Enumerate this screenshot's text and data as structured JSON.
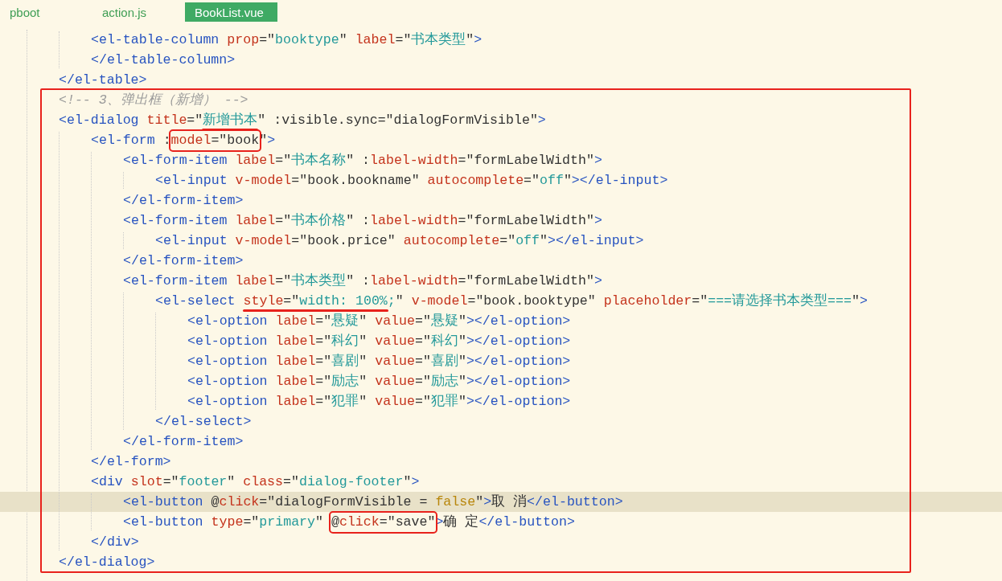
{
  "tabs": [
    {
      "label": "pboot",
      "selected": false
    },
    {
      "label": "action.js",
      "selected": false
    },
    {
      "label": "BookList.vue",
      "selected": true
    }
  ],
  "sections": [
    {
      "boxed": false,
      "lines": [
        {
          "children": [
            {
              "current": false,
              "tokens": [
                {
                  "kind": "tag",
                  "text": "<el-table-column"
                },
                {
                  "kind": "attr",
                  "text": " prop"
                },
                {
                  "kind": "punct",
                  "text": "=\""
                },
                {
                  "kind": "string",
                  "text": "booktype"
                },
                {
                  "kind": "punct",
                  "text": "\""
                },
                {
                  "kind": "attr",
                  "text": " label"
                },
                {
                  "kind": "punct",
                  "text": "=\""
                },
                {
                  "kind": "string",
                  "text": "书本类型"
                },
                {
                  "kind": "punct",
                  "text": "\""
                },
                {
                  "kind": "tag",
                  "text": ">"
                }
              ]
            },
            {
              "current": false,
              "tokens": [
                {
                  "kind": "tag",
                  "text": "</el-table-column>"
                }
              ]
            }
          ]
        },
        {
          "current": false,
          "tokens": [
            {
              "kind": "tag",
              "text": "</el-table>"
            }
          ]
        }
      ]
    },
    {
      "boxed": true,
      "lines": [
        {
          "current": false,
          "tokens": [
            {
              "kind": "comment",
              "text": "<!-- 3、弹出框（新增） -->"
            }
          ]
        },
        {
          "current": false,
          "tokens": [
            {
              "kind": "tag",
              "text": "<el-dialog"
            },
            {
              "kind": "attr",
              "text": " title"
            },
            {
              "kind": "punct",
              "text": "=\""
            },
            {
              "kind": "underlined",
              "tokens": [
                {
                  "kind": "string",
                  "text": "新增书本"
                }
              ]
            },
            {
              "kind": "punct",
              "text": "\""
            },
            {
              "kind": "punct",
              "text": " :visible.sync"
            },
            {
              "kind": "punct",
              "text": "=\""
            },
            {
              "kind": "expr",
              "text": "dialogFormVisible"
            },
            {
              "kind": "punct",
              "text": "\""
            },
            {
              "kind": "tag",
              "text": ">"
            }
          ],
          "children": [
            {
              "current": false,
              "tokens": [
                {
                  "kind": "tag",
                  "text": "<el-form"
                },
                {
                  "kind": "punct",
                  "text": " :"
                },
                {
                  "kind": "boxed",
                  "tokens": [
                    {
                      "kind": "attr",
                      "text": "model"
                    },
                    {
                      "kind": "punct",
                      "text": "=\""
                    },
                    {
                      "kind": "expr",
                      "text": "book"
                    }
                  ]
                },
                {
                  "kind": "punct",
                  "text": "\""
                },
                {
                  "kind": "tag",
                  "text": ">"
                }
              ],
              "children": [
                {
                  "current": false,
                  "tokens": [
                    {
                      "kind": "tag",
                      "text": "<el-form-item"
                    },
                    {
                      "kind": "attr",
                      "text": " label"
                    },
                    {
                      "kind": "punct",
                      "text": "=\""
                    },
                    {
                      "kind": "string",
                      "text": "书本名称"
                    },
                    {
                      "kind": "punct",
                      "text": "\""
                    },
                    {
                      "kind": "punct",
                      "text": " :"
                    },
                    {
                      "kind": "attr",
                      "text": "label-width"
                    },
                    {
                      "kind": "punct",
                      "text": "=\""
                    },
                    {
                      "kind": "expr",
                      "text": "formLabelWidth"
                    },
                    {
                      "kind": "punct",
                      "text": "\""
                    },
                    {
                      "kind": "tag",
                      "text": ">"
                    }
                  ],
                  "children": [
                    {
                      "current": false,
                      "tokens": [
                        {
                          "kind": "tag",
                          "text": "<el-input"
                        },
                        {
                          "kind": "attr",
                          "text": " v-model"
                        },
                        {
                          "kind": "punct",
                          "text": "=\""
                        },
                        {
                          "kind": "expr",
                          "text": "book.bookname"
                        },
                        {
                          "kind": "punct",
                          "text": "\""
                        },
                        {
                          "kind": "attr",
                          "text": " autocomplete"
                        },
                        {
                          "kind": "punct",
                          "text": "=\""
                        },
                        {
                          "kind": "string",
                          "text": "off"
                        },
                        {
                          "kind": "punct",
                          "text": "\""
                        },
                        {
                          "kind": "tag",
                          "text": "></el-input>"
                        }
                      ]
                    }
                  ]
                },
                {
                  "current": false,
                  "tokens": [
                    {
                      "kind": "tag",
                      "text": "</el-form-item>"
                    }
                  ]
                },
                {
                  "current": false,
                  "tokens": [
                    {
                      "kind": "tag",
                      "text": "<el-form-item"
                    },
                    {
                      "kind": "attr",
                      "text": " label"
                    },
                    {
                      "kind": "punct",
                      "text": "=\""
                    },
                    {
                      "kind": "string",
                      "text": "书本价格"
                    },
                    {
                      "kind": "punct",
                      "text": "\""
                    },
                    {
                      "kind": "punct",
                      "text": " :"
                    },
                    {
                      "kind": "attr",
                      "text": "label-width"
                    },
                    {
                      "kind": "punct",
                      "text": "=\""
                    },
                    {
                      "kind": "expr",
                      "text": "formLabelWidth"
                    },
                    {
                      "kind": "punct",
                      "text": "\""
                    },
                    {
                      "kind": "tag",
                      "text": ">"
                    }
                  ],
                  "children": [
                    {
                      "current": false,
                      "tokens": [
                        {
                          "kind": "tag",
                          "text": "<el-input"
                        },
                        {
                          "kind": "attr",
                          "text": " v-model"
                        },
                        {
                          "kind": "punct",
                          "text": "=\""
                        },
                        {
                          "kind": "expr",
                          "text": "book.price"
                        },
                        {
                          "kind": "punct",
                          "text": "\""
                        },
                        {
                          "kind": "attr",
                          "text": " autocomplete"
                        },
                        {
                          "kind": "punct",
                          "text": "=\""
                        },
                        {
                          "kind": "string",
                          "text": "off"
                        },
                        {
                          "kind": "punct",
                          "text": "\""
                        },
                        {
                          "kind": "tag",
                          "text": "></el-input>"
                        }
                      ]
                    }
                  ]
                },
                {
                  "current": false,
                  "tokens": [
                    {
                      "kind": "tag",
                      "text": "</el-form-item>"
                    }
                  ]
                },
                {
                  "current": false,
                  "tokens": [
                    {
                      "kind": "tag",
                      "text": "<el-form-item"
                    },
                    {
                      "kind": "attr",
                      "text": " label"
                    },
                    {
                      "kind": "punct",
                      "text": "=\""
                    },
                    {
                      "kind": "string",
                      "text": "书本类型"
                    },
                    {
                      "kind": "punct",
                      "text": "\""
                    },
                    {
                      "kind": "punct",
                      "text": " :"
                    },
                    {
                      "kind": "attr",
                      "text": "label-width"
                    },
                    {
                      "kind": "punct",
                      "text": "=\""
                    },
                    {
                      "kind": "expr",
                      "text": "formLabelWidth"
                    },
                    {
                      "kind": "punct",
                      "text": "\""
                    },
                    {
                      "kind": "tag",
                      "text": ">"
                    }
                  ],
                  "children": [
                    {
                      "current": false,
                      "tokens": [
                        {
                          "kind": "tag",
                          "text": "<el-select "
                        },
                        {
                          "kind": "underlined",
                          "tokens": [
                            {
                              "kind": "attr",
                              "text": "style"
                            },
                            {
                              "kind": "punct",
                              "text": "=\""
                            },
                            {
                              "kind": "string",
                              "text": "width: 100%"
                            }
                          ]
                        },
                        {
                          "kind": "string",
                          "text": ";"
                        },
                        {
                          "kind": "punct",
                          "text": "\""
                        },
                        {
                          "kind": "attr",
                          "text": " v-model"
                        },
                        {
                          "kind": "punct",
                          "text": "=\""
                        },
                        {
                          "kind": "expr",
                          "text": "book.booktype"
                        },
                        {
                          "kind": "punct",
                          "text": "\""
                        },
                        {
                          "kind": "attr",
                          "text": " placeholder"
                        },
                        {
                          "kind": "punct",
                          "text": "=\""
                        },
                        {
                          "kind": "string",
                          "text": "===请选择书本类型==="
                        },
                        {
                          "kind": "punct",
                          "text": "\""
                        },
                        {
                          "kind": "tag",
                          "text": ">"
                        }
                      ],
                      "children": [
                        {
                          "current": false,
                          "tokens": [
                            {
                              "kind": "tag",
                              "text": "<el-option"
                            },
                            {
                              "kind": "attr",
                              "text": " label"
                            },
                            {
                              "kind": "punct",
                              "text": "=\""
                            },
                            {
                              "kind": "string",
                              "text": "悬疑"
                            },
                            {
                              "kind": "punct",
                              "text": "\""
                            },
                            {
                              "kind": "attr",
                              "text": " value"
                            },
                            {
                              "kind": "punct",
                              "text": "=\""
                            },
                            {
                              "kind": "string",
                              "text": "悬疑"
                            },
                            {
                              "kind": "punct",
                              "text": "\""
                            },
                            {
                              "kind": "tag",
                              "text": "></el-option>"
                            }
                          ]
                        },
                        {
                          "current": false,
                          "tokens": [
                            {
                              "kind": "tag",
                              "text": "<el-option"
                            },
                            {
                              "kind": "attr",
                              "text": " label"
                            },
                            {
                              "kind": "punct",
                              "text": "=\""
                            },
                            {
                              "kind": "string",
                              "text": "科幻"
                            },
                            {
                              "kind": "punct",
                              "text": "\""
                            },
                            {
                              "kind": "attr",
                              "text": " value"
                            },
                            {
                              "kind": "punct",
                              "text": "=\""
                            },
                            {
                              "kind": "string",
                              "text": "科幻"
                            },
                            {
                              "kind": "punct",
                              "text": "\""
                            },
                            {
                              "kind": "tag",
                              "text": "></el-option>"
                            }
                          ]
                        },
                        {
                          "current": false,
                          "tokens": [
                            {
                              "kind": "tag",
                              "text": "<el-option"
                            },
                            {
                              "kind": "attr",
                              "text": " label"
                            },
                            {
                              "kind": "punct",
                              "text": "=\""
                            },
                            {
                              "kind": "string",
                              "text": "喜剧"
                            },
                            {
                              "kind": "punct",
                              "text": "\""
                            },
                            {
                              "kind": "attr",
                              "text": " value"
                            },
                            {
                              "kind": "punct",
                              "text": "=\""
                            },
                            {
                              "kind": "string",
                              "text": "喜剧"
                            },
                            {
                              "kind": "punct",
                              "text": "\""
                            },
                            {
                              "kind": "tag",
                              "text": "></el-option>"
                            }
                          ]
                        },
                        {
                          "current": false,
                          "tokens": [
                            {
                              "kind": "tag",
                              "text": "<el-option"
                            },
                            {
                              "kind": "attr",
                              "text": " label"
                            },
                            {
                              "kind": "punct",
                              "text": "=\""
                            },
                            {
                              "kind": "string",
                              "text": "励志"
                            },
                            {
                              "kind": "punct",
                              "text": "\""
                            },
                            {
                              "kind": "attr",
                              "text": " value"
                            },
                            {
                              "kind": "punct",
                              "text": "=\""
                            },
                            {
                              "kind": "string",
                              "text": "励志"
                            },
                            {
                              "kind": "punct",
                              "text": "\""
                            },
                            {
                              "kind": "tag",
                              "text": "></el-option>"
                            }
                          ]
                        },
                        {
                          "current": false,
                          "tokens": [
                            {
                              "kind": "tag",
                              "text": "<el-option"
                            },
                            {
                              "kind": "attr",
                              "text": " label"
                            },
                            {
                              "kind": "punct",
                              "text": "=\""
                            },
                            {
                              "kind": "string",
                              "text": "犯罪"
                            },
                            {
                              "kind": "punct",
                              "text": "\""
                            },
                            {
                              "kind": "attr",
                              "text": " value"
                            },
                            {
                              "kind": "punct",
                              "text": "=\""
                            },
                            {
                              "kind": "string",
                              "text": "犯罪"
                            },
                            {
                              "kind": "punct",
                              "text": "\""
                            },
                            {
                              "kind": "tag",
                              "text": "></el-option>"
                            }
                          ]
                        }
                      ]
                    },
                    {
                      "current": false,
                      "tokens": [
                        {
                          "kind": "tag",
                          "text": "</el-select>"
                        }
                      ]
                    }
                  ]
                },
                {
                  "current": false,
                  "tokens": [
                    {
                      "kind": "tag",
                      "text": "</el-form-item>"
                    }
                  ]
                }
              ]
            },
            {
              "current": false,
              "tokens": [
                {
                  "kind": "tag",
                  "text": "</el-form>"
                }
              ]
            },
            {
              "current": false,
              "tokens": [
                {
                  "kind": "tag",
                  "text": "<div"
                },
                {
                  "kind": "attr",
                  "text": " slot"
                },
                {
                  "kind": "punct",
                  "text": "=\""
                },
                {
                  "kind": "string",
                  "text": "footer"
                },
                {
                  "kind": "punct",
                  "text": "\""
                },
                {
                  "kind": "attr",
                  "text": " class"
                },
                {
                  "kind": "punct",
                  "text": "=\""
                },
                {
                  "kind": "string",
                  "text": "dialog-footer"
                },
                {
                  "kind": "punct",
                  "text": "\""
                },
                {
                  "kind": "tag",
                  "text": ">"
                }
              ],
              "children": [
                {
                  "current": true,
                  "tokens": [
                    {
                      "kind": "tag",
                      "text": "<el-button"
                    },
                    {
                      "kind": "punct",
                      "text": " @"
                    },
                    {
                      "kind": "attr",
                      "text": "click"
                    },
                    {
                      "kind": "punct",
                      "text": "=\""
                    },
                    {
                      "kind": "expr",
                      "text": "dialogFormVisible = "
                    },
                    {
                      "kind": "keyword",
                      "text": "false"
                    },
                    {
                      "kind": "punct",
                      "text": "\""
                    },
                    {
                      "kind": "tag",
                      "text": ">"
                    },
                    {
                      "kind": "text",
                      "text": "取 消"
                    },
                    {
                      "kind": "tag",
                      "text": "</el-button>"
                    }
                  ]
                },
                {
                  "current": false,
                  "tokens": [
                    {
                      "kind": "tag",
                      "text": "<el-button"
                    },
                    {
                      "kind": "attr",
                      "text": " type"
                    },
                    {
                      "kind": "punct",
                      "text": "=\""
                    },
                    {
                      "kind": "string",
                      "text": "primary"
                    },
                    {
                      "kind": "punct",
                      "text": "\" "
                    },
                    {
                      "kind": "boxed",
                      "tokens": [
                        {
                          "kind": "punct",
                          "text": "@"
                        },
                        {
                          "kind": "attr",
                          "text": "click"
                        },
                        {
                          "kind": "punct",
                          "text": "=\""
                        },
                        {
                          "kind": "expr",
                          "text": "save"
                        },
                        {
                          "kind": "punct",
                          "text": "\""
                        }
                      ]
                    },
                    {
                      "kind": "tag",
                      "text": ">"
                    },
                    {
                      "kind": "text",
                      "text": "确 定"
                    },
                    {
                      "kind": "tag",
                      "text": "</el-button>"
                    }
                  ]
                }
              ]
            },
            {
              "current": false,
              "tokens": [
                {
                  "kind": "tag",
                  "text": "</div>"
                }
              ]
            }
          ]
        },
        {
          "current": false,
          "tokens": [
            {
              "kind": "tag",
              "text": "</el-dialog>"
            }
          ]
        }
      ]
    }
  ]
}
